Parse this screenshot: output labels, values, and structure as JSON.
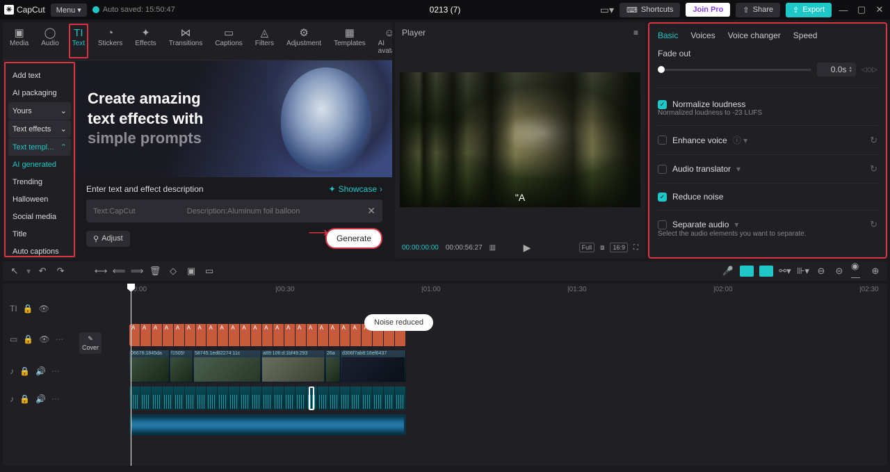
{
  "app": {
    "name": "CapCut",
    "menu": "Menu",
    "autosaved": "Auto saved: 15:50:47",
    "project": "0213 (7)"
  },
  "topbtns": {
    "shortcuts": "Shortcuts",
    "joinpro": "Join Pro",
    "share": "Share",
    "export": "Export"
  },
  "tools": {
    "media": "Media",
    "audio": "Audio",
    "text": "Text",
    "stickers": "Stickers",
    "effects": "Effects",
    "transitions": "Transitions",
    "captions": "Captions",
    "filters": "Filters",
    "adjustment": "Adjustment",
    "templates": "Templates",
    "aiavatars": "AI avatars"
  },
  "side": {
    "addtext": "Add text",
    "aipkg": "AI packaging",
    "yours": "Yours",
    "txeffects": "Text effects",
    "txtmpl": "Text templ...",
    "aigen": "AI generated",
    "trending": "Trending",
    "halloween": "Halloween",
    "social": "Social media",
    "title": "Title",
    "autocap": "Auto captions"
  },
  "hero": {
    "line1": "Create amazing",
    "line2": "text effects with",
    "line3": "simple prompts"
  },
  "prompt": {
    "label": "Enter text and effect description",
    "showcase": "Showcase",
    "text_ph": "Text:CapCut",
    "desc_ph": "Description:Aluminum foil balloon",
    "adjust": "Adjust",
    "generate": "Generate"
  },
  "player": {
    "title": "Player",
    "subtitle": "\"A",
    "cur": "00:00:00:00",
    "dur": "00:00:56:27",
    "full": "Full",
    "ratio": "16:9"
  },
  "props": {
    "tabs": {
      "basic": "Basic",
      "voices": "Voices",
      "changer": "Voice changer",
      "speed": "Speed"
    },
    "fadeout": "Fade out",
    "fade_val": "0.0s",
    "norm": "Normalize loudness",
    "norm_sub": "Normalized loudness to -23 LUFS",
    "enhance": "Enhance voice",
    "audiotr": "Audio translator",
    "reduce": "Reduce noise",
    "sep": "Separate audio",
    "sep_sub": "Select the audio elements you want to separate."
  },
  "timeline": {
    "toast": "Noise reduced",
    "cover": "Cover",
    "ticks": [
      "00:00",
      "|00:30",
      "|01:00",
      "|01:30",
      "|02:00",
      "|02:30"
    ],
    "vids": [
      "06676:1845da",
      "f1505!",
      "58745:1ed82274:11c",
      "a89:106:d:1bf49:293",
      "26a",
      "d306f7ab8:16ef6437"
    ]
  }
}
